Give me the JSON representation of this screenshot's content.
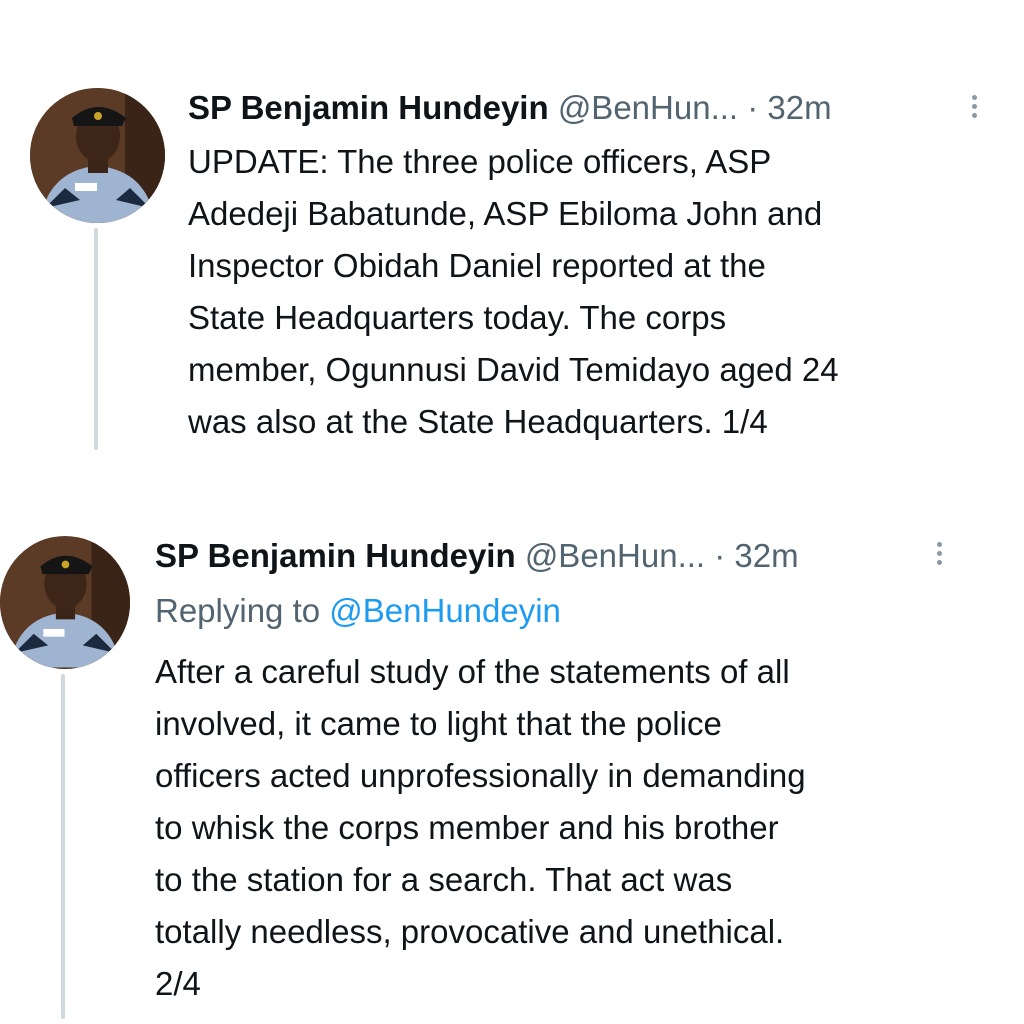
{
  "tweets": [
    {
      "author_name": "SP Benjamin Hundeyin",
      "author_handle": "@BenHun...",
      "separator": "·",
      "time": "32m",
      "avatar_icon": "officer-avatar",
      "replying_prefix": "",
      "replying_mention": "",
      "lines": [
        "UPDATE: The three police officers, ASP",
        "Adedeji Babatunde, ASP Ebiloma John and",
        "Inspector Obidah Daniel reported at the",
        "State Headquarters today. The corps",
        "member, Ogunnusi David Temidayo aged 24",
        "was also at the State Headquarters. 1/4"
      ]
    },
    {
      "author_name": "SP Benjamin Hundeyin",
      "author_handle": "@BenHun...",
      "separator": "·",
      "time": "32m",
      "avatar_icon": "officer-avatar",
      "replying_prefix": "Replying to ",
      "replying_mention": "@BenHundeyin",
      "lines": [
        "After a careful study of the statements of all",
        "involved, it came to light that the police",
        "officers acted unprofessionally in demanding",
        "to whisk the corps member and his brother",
        "to the station for a search. That act was",
        "totally needless, provocative and unethical.",
        "2/4"
      ]
    }
  ]
}
